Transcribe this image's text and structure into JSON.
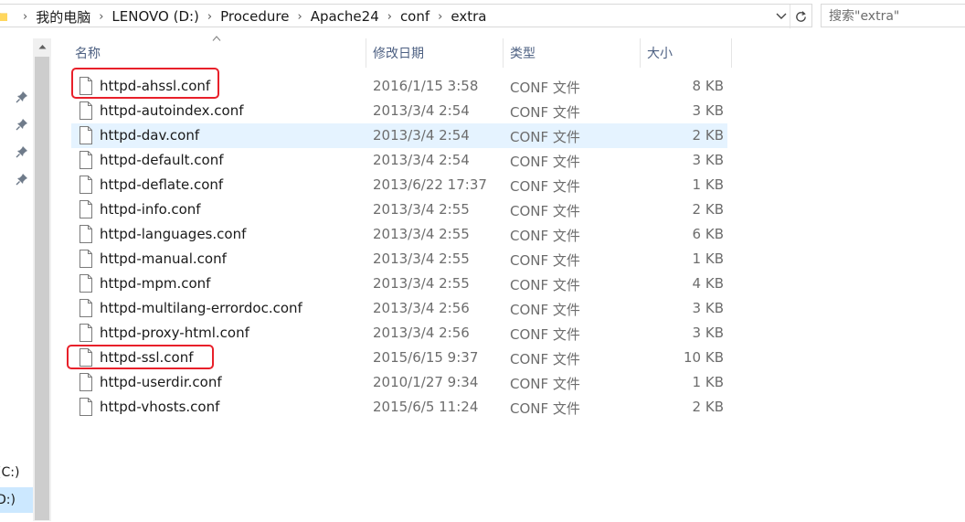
{
  "address_bar": {
    "crumbs": [
      "我的电脑",
      "LENOVO (D:)",
      "Procedure",
      "Apache24",
      "conf",
      "extra"
    ]
  },
  "search": {
    "placeholder": "搜索\"extra\""
  },
  "nav": {
    "drives": [
      {
        "label": "(C:)"
      },
      {
        "label": "D:)"
      }
    ]
  },
  "columns": {
    "name": "名称",
    "date": "修改日期",
    "type": "类型",
    "size": "大小"
  },
  "files": [
    {
      "name": "httpd-ahssl.conf",
      "date": "2016/1/15 3:58",
      "type": "CONF 文件",
      "size": "8 KB"
    },
    {
      "name": "httpd-autoindex.conf",
      "date": "2013/3/4 2:54",
      "type": "CONF 文件",
      "size": "3 KB"
    },
    {
      "name": "httpd-dav.conf",
      "date": "2013/3/4 2:54",
      "type": "CONF 文件",
      "size": "2 KB"
    },
    {
      "name": "httpd-default.conf",
      "date": "2013/3/4 2:54",
      "type": "CONF 文件",
      "size": "3 KB"
    },
    {
      "name": "httpd-deflate.conf",
      "date": "2013/6/22 17:37",
      "type": "CONF 文件",
      "size": "1 KB"
    },
    {
      "name": "httpd-info.conf",
      "date": "2013/3/4 2:55",
      "type": "CONF 文件",
      "size": "2 KB"
    },
    {
      "name": "httpd-languages.conf",
      "date": "2013/3/4 2:55",
      "type": "CONF 文件",
      "size": "6 KB"
    },
    {
      "name": "httpd-manual.conf",
      "date": "2013/3/4 2:55",
      "type": "CONF 文件",
      "size": "1 KB"
    },
    {
      "name": "httpd-mpm.conf",
      "date": "2013/3/4 2:55",
      "type": "CONF 文件",
      "size": "4 KB"
    },
    {
      "name": "httpd-multilang-errordoc.conf",
      "date": "2013/3/4 2:56",
      "type": "CONF 文件",
      "size": "3 KB"
    },
    {
      "name": "httpd-proxy-html.conf",
      "date": "2013/3/4 2:56",
      "type": "CONF 文件",
      "size": "3 KB"
    },
    {
      "name": "httpd-ssl.conf",
      "date": "2015/6/15 9:37",
      "type": "CONF 文件",
      "size": "10 KB"
    },
    {
      "name": "httpd-userdir.conf",
      "date": "2010/1/27 9:34",
      "type": "CONF 文件",
      "size": "1 KB"
    },
    {
      "name": "httpd-vhosts.conf",
      "date": "2015/6/5 11:24",
      "type": "CONF 文件",
      "size": "2 KB"
    }
  ],
  "colors": {
    "hover_row": "#e5f3ff",
    "selected_nav": "#cce8ff",
    "annotation_red": "#e8202a",
    "header_text": "#4d6082"
  }
}
